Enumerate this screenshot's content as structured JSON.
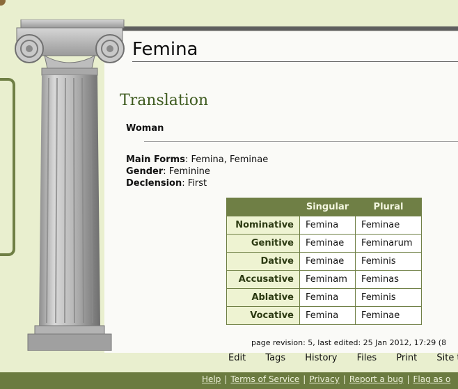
{
  "page": {
    "title": "Femina",
    "section_heading": "Translation",
    "translation": "Woman"
  },
  "forms": {
    "main_forms_label": "Main Forms",
    "main_forms_value": ": Femina, Feminae",
    "gender_label": "Gender",
    "gender_value": ": Feminine",
    "declension_label": "Declension",
    "declension_value": ": First"
  },
  "declension_table": {
    "headers": [
      "",
      "Singular",
      "Plural"
    ],
    "rows": [
      {
        "case": "Nominative",
        "singular": "Femina",
        "plural": "Feminae"
      },
      {
        "case": "Genitive",
        "singular": "Feminae",
        "plural": "Feminarum"
      },
      {
        "case": "Dative",
        "singular": "Feminae",
        "plural": "Feminis"
      },
      {
        "case": "Accusative",
        "singular": "Feminam",
        "plural": "Feminas"
      },
      {
        "case": "Ablative",
        "singular": "Femina",
        "plural": "Feminis"
      },
      {
        "case": "Vocative",
        "singular": "Femina",
        "plural": "Feminae"
      }
    ]
  },
  "revision": "page revision: 5, last edited: 25 Jan 2012, 17:29 (8",
  "page_options": [
    "Edit",
    "Tags",
    "History",
    "Files",
    "Print",
    "Site tool"
  ],
  "footer_links": [
    "Help",
    "Terms of Service",
    "Privacy",
    "Report a bug",
    "Flag as o"
  ],
  "colors": {
    "background": "#e9efcf",
    "accent_green": "#6f7f45",
    "heading_green": "#3d5a1e",
    "footer": "#6b7b40"
  }
}
